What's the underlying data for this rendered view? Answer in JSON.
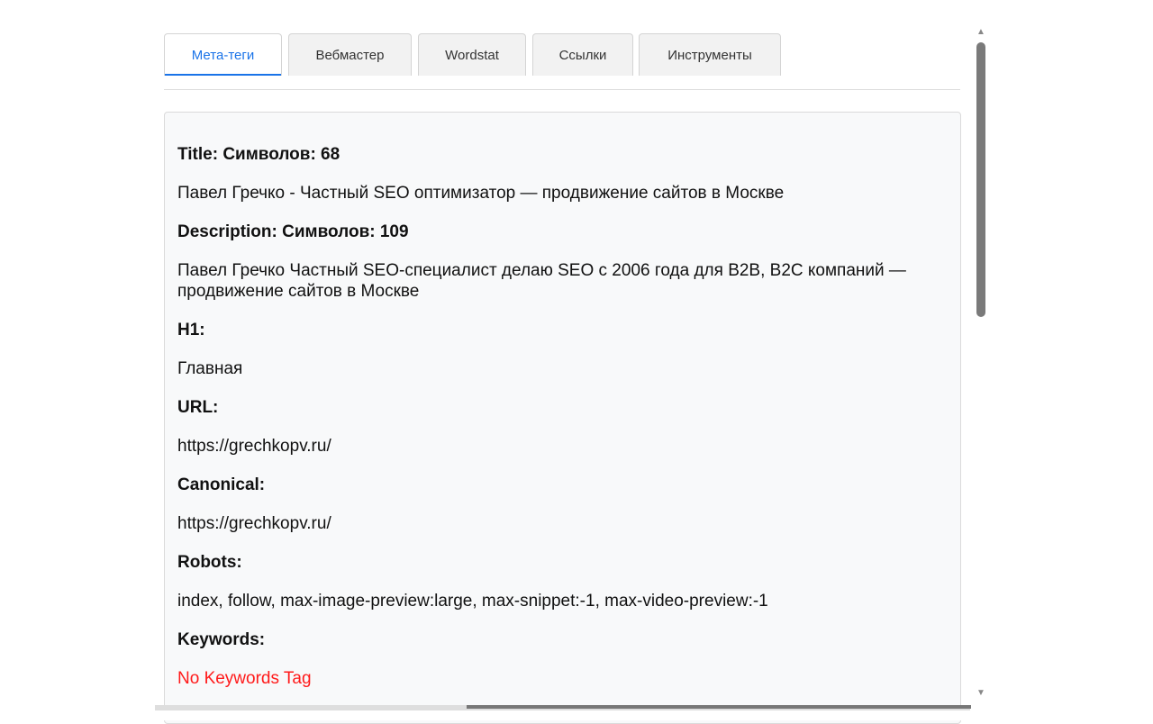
{
  "tabs": [
    {
      "label": "Мета-теги",
      "active": true
    },
    {
      "label": "Вебмастер",
      "active": false
    },
    {
      "label": "Wordstat",
      "active": false
    },
    {
      "label": "Ссылки",
      "active": false
    },
    {
      "label": "Инструменты",
      "active": false
    }
  ],
  "meta": {
    "title_label": "Title: Символов: 68",
    "title_value": "Павел Гречко - Частный SEO оптимизатор — продвижение сайтов в Москве",
    "description_label": "Description: Символов: 109",
    "description_value": "Павел Гречко Частный SEO-специалист делаю SEO с 2006 года для B2B, B2C компаний — продвижение сайтов в Москве",
    "h1_label": "H1:",
    "h1_value": "Главная",
    "url_label": "URL:",
    "url_value": "https://grechkopv.ru/",
    "canonical_label": "Canonical:",
    "canonical_value": "https://grechkopv.ru/",
    "robots_label": "Robots:",
    "robots_value": "index, follow, max-image-preview:large, max-snippet:-1, max-video-preview:-1",
    "keywords_label": "Keywords:",
    "keywords_value": "No Keywords Tag"
  },
  "colors": {
    "accent": "#1a73e8",
    "error": "#ff1a1a",
    "panel_bg": "#f8f9fa"
  },
  "icons": {
    "scroll_up": "chevron-up-icon",
    "scroll_down": "chevron-down-icon"
  }
}
